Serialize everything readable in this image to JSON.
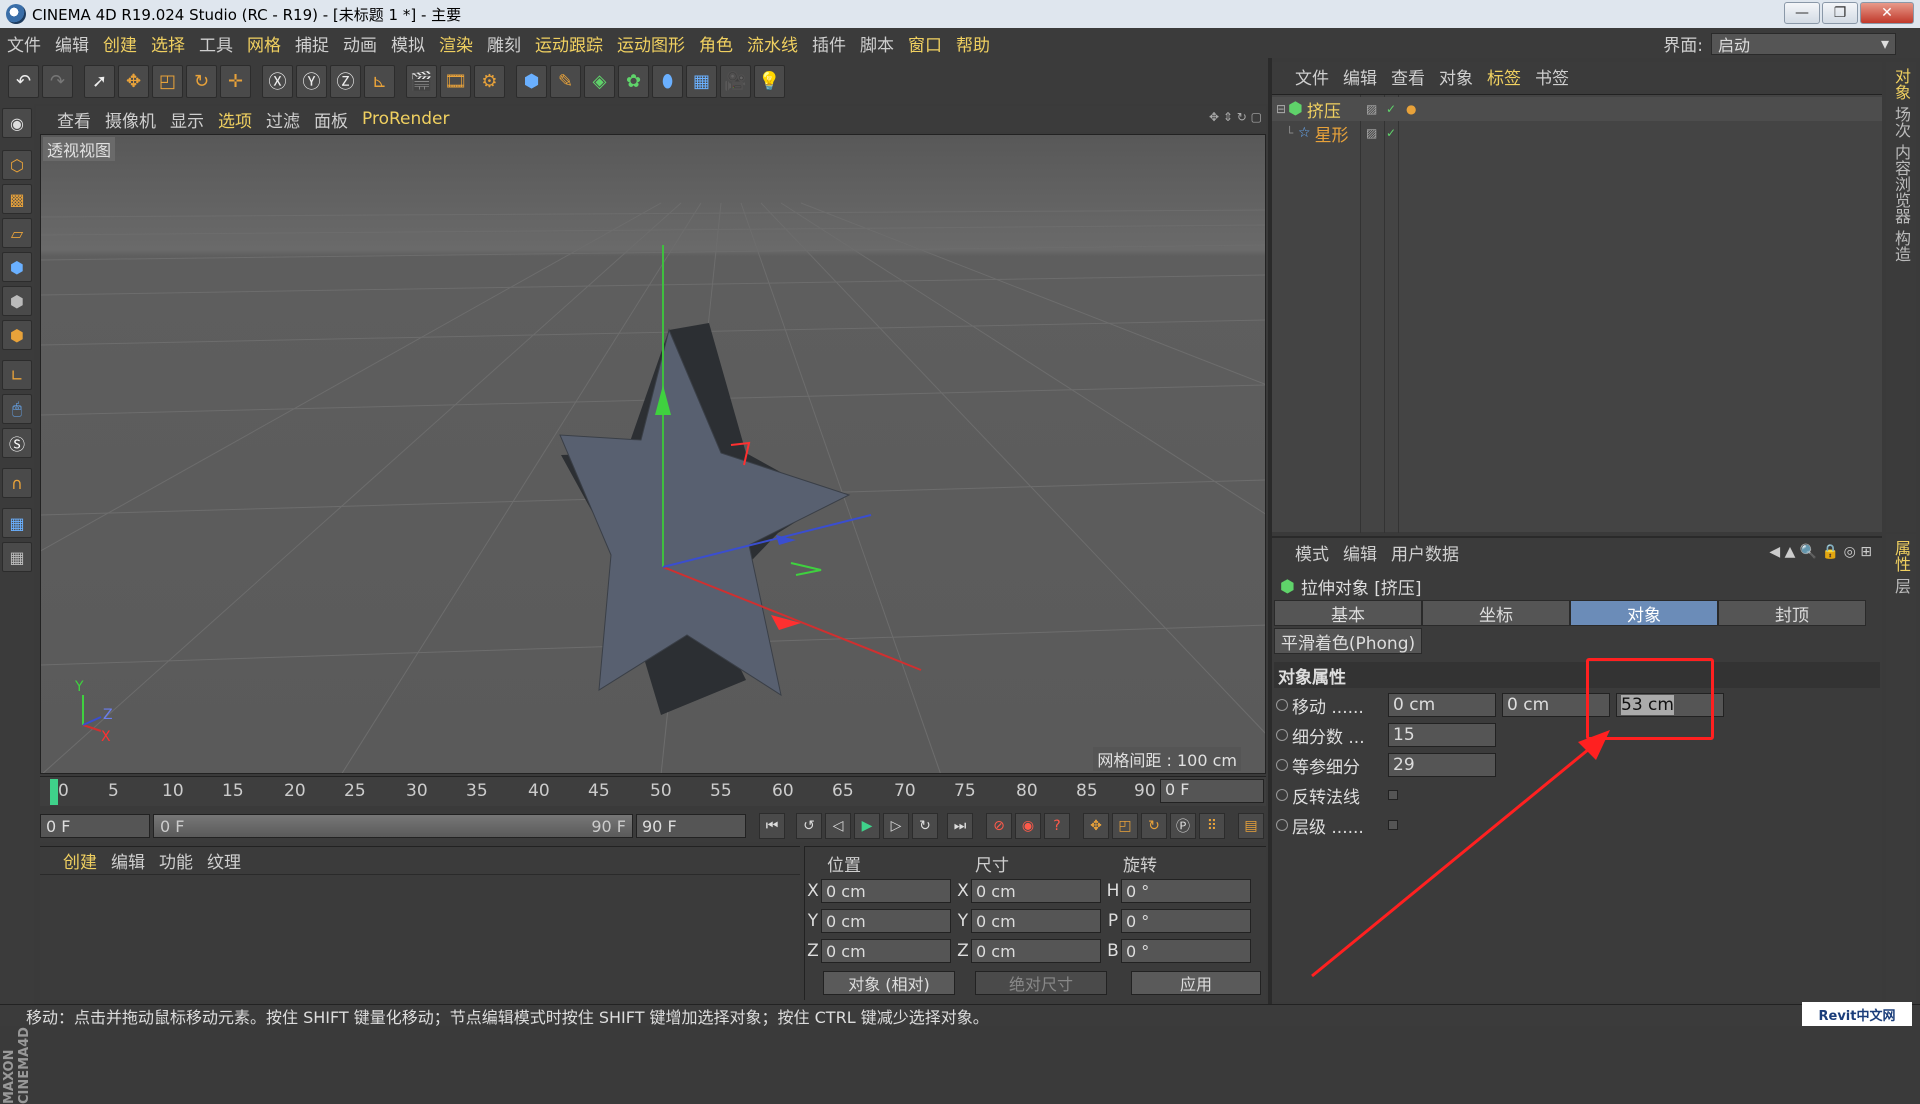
{
  "window": {
    "title": "CINEMA 4D R19.024 Studio (RC - R19) - [未标题 1 *] - 主要",
    "buttons": {
      "minimize": "—",
      "restore": "❐",
      "close": "✕"
    }
  },
  "menu": {
    "items": [
      "文件",
      "编辑",
      "创建",
      "选择",
      "工具",
      "网格",
      "捕捉",
      "动画",
      "模拟",
      "渲染",
      "雕刻",
      "运动跟踪",
      "运动图形",
      "角色",
      "流水线",
      "插件",
      "脚本",
      "窗口",
      "帮助"
    ],
    "interface_label": "界面:",
    "interface_value": "启动"
  },
  "viewport": {
    "menu": [
      "查看",
      "摄像机",
      "显示",
      "选项",
      "过滤",
      "面板",
      "ProRender"
    ],
    "label": "透视视图",
    "grid_spacing": "网格间距 : 100 cm",
    "axis": {
      "x": "X",
      "y": "Y",
      "z": "Z"
    }
  },
  "timeline": {
    "ticks": [
      "0",
      "5",
      "10",
      "15",
      "20",
      "25",
      "30",
      "35",
      "40",
      "45",
      "50",
      "55",
      "60",
      "65",
      "70",
      "75",
      "80",
      "85",
      "90"
    ],
    "current_frame": "0 F",
    "start_frame": "0 F",
    "slider_start": "0 F",
    "slider_end": "90 F",
    "end_frame": "90 F"
  },
  "materials": {
    "menu": [
      "创建",
      "编辑",
      "功能",
      "纹理"
    ]
  },
  "coords": {
    "headers": {
      "position": "位置",
      "size": "尺寸",
      "rotation": "旋转"
    },
    "rows": [
      {
        "pl": "X",
        "pv": "0 cm",
        "sl": "X",
        "sv": "0 cm",
        "rl": "H",
        "rv": "0 °"
      },
      {
        "pl": "Y",
        "pv": "0 cm",
        "sl": "Y",
        "sv": "0 cm",
        "rl": "P",
        "rv": "0 °"
      },
      {
        "pl": "Z",
        "pv": "0 cm",
        "sl": "Z",
        "sv": "0 cm",
        "rl": "B",
        "rv": "0 °"
      }
    ],
    "mode": "对象 (相对)",
    "size_mode": "绝对尺寸",
    "apply": "应用"
  },
  "objects": {
    "menu": [
      "文件",
      "编辑",
      "查看",
      "对象",
      "标签",
      "书签"
    ],
    "items": [
      {
        "name": "挤压"
      },
      {
        "name": "星形"
      }
    ]
  },
  "right_tabs": {
    "top": [
      "对象",
      "场次",
      "内容浏览器",
      "构造"
    ],
    "bottom": [
      "属性",
      "层"
    ]
  },
  "attributes": {
    "menu": [
      "模式",
      "编辑",
      "用户数据"
    ],
    "object_title": "拉伸对象 [挤压]",
    "tabs": [
      "基本",
      "坐标",
      "对象",
      "封顶"
    ],
    "active_tab": "对象",
    "phong_tab": "平滑着色(Phong)",
    "section": "对象属性",
    "rows": {
      "move": {
        "label": "移动 ......",
        "x": "0 cm",
        "y": "0 cm",
        "z": "53 cm"
      },
      "subdiv": {
        "label": "细分数 ...",
        "value": "15"
      },
      "iso": {
        "label": "等参细分",
        "value": "29"
      },
      "flip": {
        "label": "反转法线"
      },
      "hier": {
        "label": "层级 ......"
      }
    }
  },
  "status": "移动：点击并拖动鼠标移动元素。按住 SHIFT 键量化移动；节点编辑模式时按住 SHIFT 键增加选择对象；按住 CTRL 键减少选择对象。",
  "watermark": "Revit中文网",
  "colors": {
    "accent": "#f0d060",
    "highlight": "#ff2020",
    "tab_active": "#6b8cb8"
  }
}
